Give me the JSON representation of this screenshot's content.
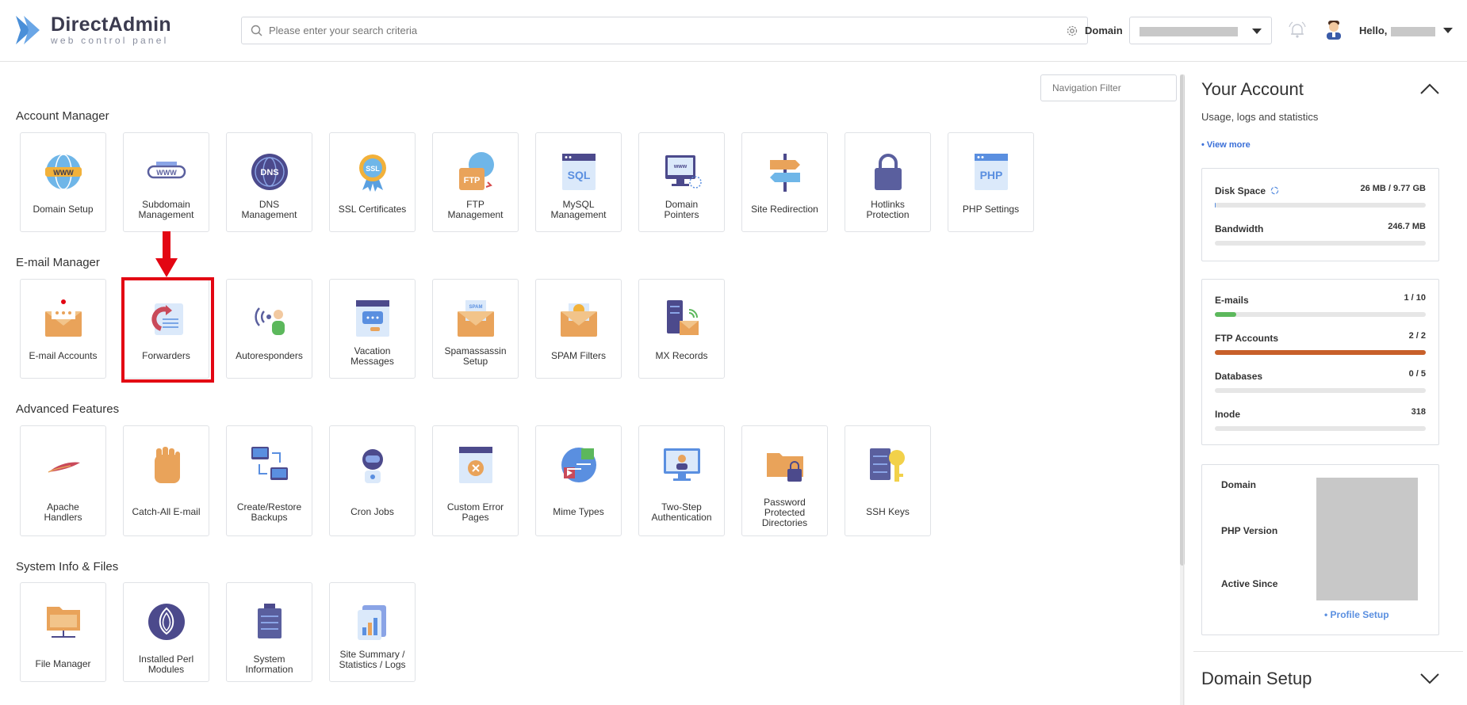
{
  "header": {
    "logo_title": "DirectAdmin",
    "logo_sub": "web control panel",
    "search_placeholder": "Please enter your search criteria",
    "domain_label": "Domain",
    "hello": "Hello,"
  },
  "nav_filter_placeholder": "Navigation Filter",
  "sections": {
    "account": {
      "title": "Account Manager",
      "items": [
        "Domain Setup",
        "Subdomain\nManagement",
        "DNS\nManagement",
        "SSL Certificates",
        "FTP\nManagement",
        "MySQL\nManagement",
        "Domain\nPointers",
        "Site Redirection",
        "Hotlinks\nProtection",
        "PHP Settings"
      ]
    },
    "email": {
      "title": "E-mail Manager",
      "items": [
        "E-mail Accounts",
        "Forwarders",
        "Autoresponders",
        "Vacation\nMessages",
        "Spamassassin\nSetup",
        "SPAM Filters",
        "MX Records"
      ]
    },
    "advanced": {
      "title": "Advanced Features",
      "items": [
        "Apache\nHandlers",
        "Catch-All E-mail",
        "Create/Restore\nBackups",
        "Cron Jobs",
        "Custom Error\nPages",
        "Mime Types",
        "Two-Step\nAuthentication",
        "Password\nProtected\nDirectories",
        "SSH Keys"
      ]
    },
    "system": {
      "title": "System Info & Files",
      "items": [
        "File Manager",
        "Installed Perl\nModules",
        "System\nInformation",
        "Site Summary /\nStatistics / Logs"
      ]
    }
  },
  "account_panel": {
    "title": "Your Account",
    "subtitle": "Usage, logs and statistics",
    "view_more": "• View more",
    "stats1": [
      {
        "name": "Disk Space",
        "value": "26 MB / 9.77 GB",
        "fill": 0.003
      },
      {
        "name": "Bandwidth",
        "value": "246.7 MB",
        "fill": 0
      }
    ],
    "stats2": [
      {
        "name": "E-mails",
        "value": "1 / 10",
        "fill": 0.1
      },
      {
        "name": "FTP Accounts",
        "value": "2 / 2",
        "fill": 1
      },
      {
        "name": "Databases",
        "value": "0 / 5",
        "fill": 0
      },
      {
        "name": "Inode",
        "value": "318",
        "fill": 0
      }
    ],
    "info": {
      "domain": "Domain",
      "php": "PHP Version",
      "since": "Active Since",
      "profile": "• Profile Setup"
    },
    "next_title": "Domain Setup"
  },
  "colors": {
    "highlight": "#e30613",
    "email_bar": "#5cb85c",
    "ftp_bar": "#c8602a",
    "link": "#3a6fd8"
  }
}
